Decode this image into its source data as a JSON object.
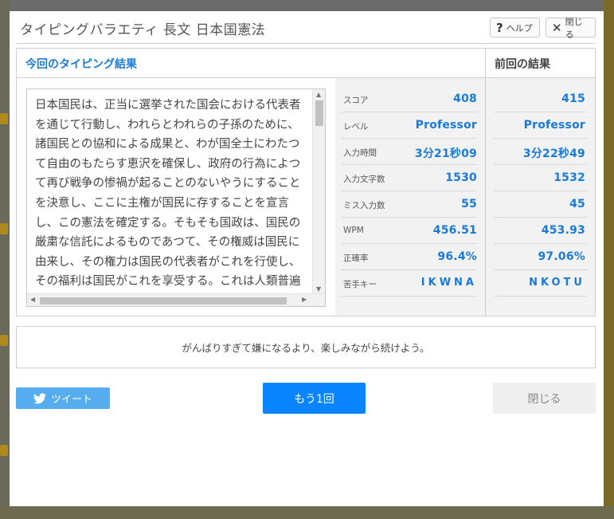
{
  "dialog": {
    "title": "タイピングバラエティ 長文 日本国憲法",
    "help_label": "ヘルプ",
    "close_label": "閉じる"
  },
  "results": {
    "current_heading": "今回のタイピング結果",
    "previous_heading": "前回の結果",
    "typed_text": "日本国民は、正当に選挙された国会における代表者を通じて行動し、われらとわれらの子孫のために、諸国民との協和による成果と、わが国全土にわたつて自由のもたらす恵沢を確保し、政府の行為によつて再び戦争の惨禍が起ることのないやうにすることを決意し、ここに主権が国民に存することを宣言し、この憲法を確定する。そもそも国政は、国民の厳粛な信託によるものであつて、その権威は国民に由来し、その権力は国民の代表者がこれを行使し、その福利は国民がこれを享受する。これは人類普遍の原理であり、この憲法は",
    "stats": [
      {
        "label": "スコア",
        "current": "408",
        "previous": "415"
      },
      {
        "label": "レベル",
        "current": "Professor",
        "previous": "Professor"
      },
      {
        "label": "入力時間",
        "current": "3分21秒09",
        "previous": "3分22秒49"
      },
      {
        "label": "入力文字数",
        "current": "1530",
        "previous": "1532"
      },
      {
        "label": "ミス入力数",
        "current": "55",
        "previous": "45"
      },
      {
        "label": "WPM",
        "current": "456.51",
        "previous": "453.93"
      },
      {
        "label": "正確率",
        "current": "96.4%",
        "previous": "97.06%"
      },
      {
        "label": "苦手キー",
        "current": "IKWNA",
        "previous": "NKOTU"
      }
    ]
  },
  "message": "がんばりすぎて嫌になるより、楽しみながら続けよう。",
  "footer": {
    "tweet_label": "ツイート",
    "retry_label": "もう1回",
    "close_label": "閉じる"
  },
  "colors": {
    "accent": "#1a7ad8",
    "retry_button": "#0a84ff",
    "tweet_button": "#55acee"
  },
  "icons": [
    "help-icon",
    "close-icon",
    "twitter-bird-icon"
  ]
}
